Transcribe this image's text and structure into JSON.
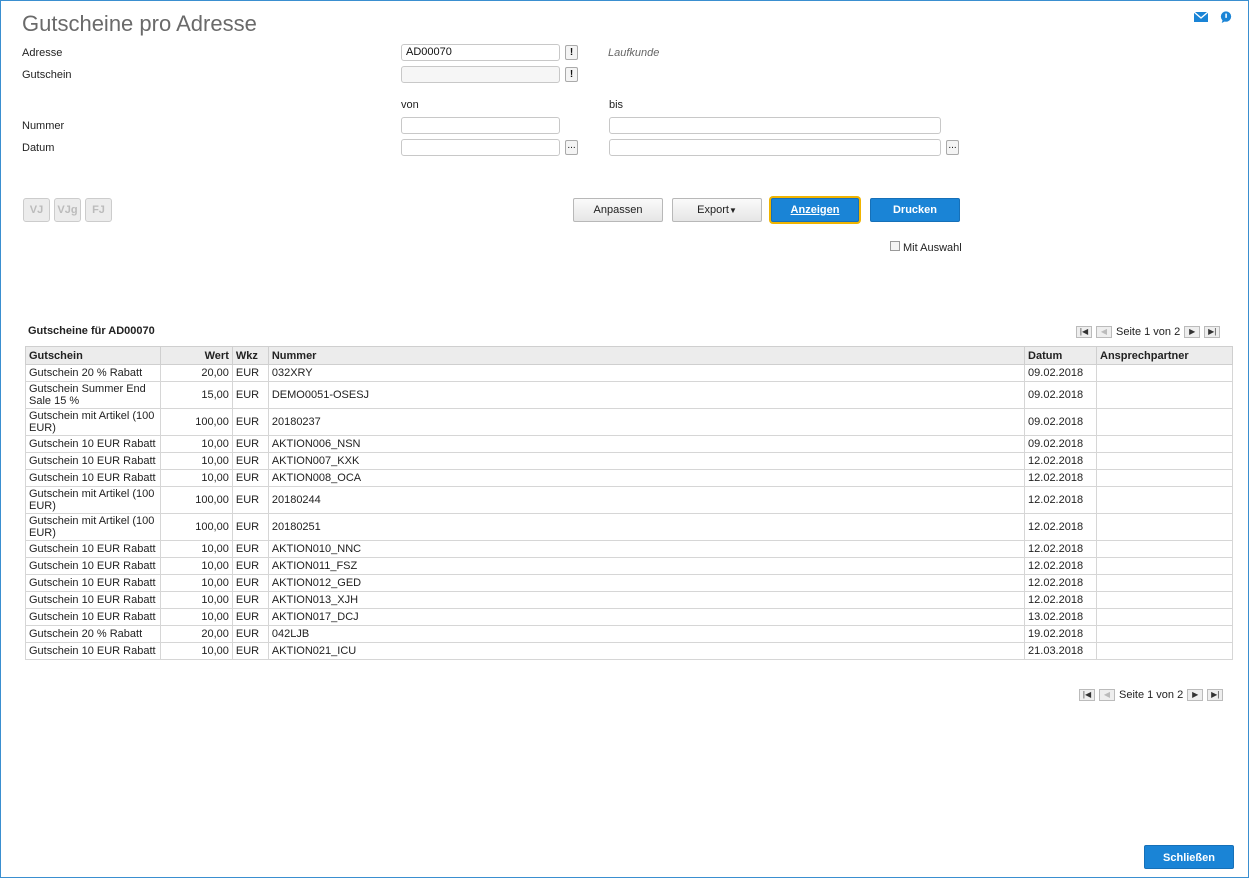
{
  "header": {
    "title": "Gutscheine pro Adresse",
    "icons": [
      "mail-icon",
      "help-chat-icon"
    ]
  },
  "form": {
    "adresse_label": "Adresse",
    "adresse_value": "AD00070",
    "adresse_name": "Laufkunde",
    "gutschein_label": "Gutschein",
    "gutschein_value": "",
    "von_label": "von",
    "bis_label": "bis",
    "nummer_label": "Nummer",
    "datum_label": "Datum",
    "nummer_von": "",
    "nummer_bis": "",
    "datum_von": "",
    "datum_bis": "",
    "info_mark": "!",
    "dots": "..."
  },
  "period_buttons": [
    "VJ",
    "VJg",
    "FJ"
  ],
  "toolbar": {
    "anpassen": "Anpassen",
    "export": "Export",
    "anzeigen": "Anzeigen",
    "drucken": "Drucken",
    "mit_auswahl": "Mit Auswahl"
  },
  "results": {
    "title": "Gutscheine für AD00070",
    "pager_text": "Seite 1 von 2",
    "columns": [
      "Gutschein",
      "Wert",
      "Wkz",
      "Nummer",
      "Datum",
      "Ansprechpartner"
    ],
    "rows": [
      [
        "Gutschein 20 % Rabatt",
        "20,00",
        "EUR",
        "032XRY",
        "09.02.2018",
        ""
      ],
      [
        "Gutschein Summer End Sale 15 %",
        "15,00",
        "EUR",
        "DEMO0051-OSESJ",
        "09.02.2018",
        ""
      ],
      [
        "Gutschein mit Artikel (100 EUR)",
        "100,00",
        "EUR",
        "20180237",
        "09.02.2018",
        ""
      ],
      [
        "Gutschein 10 EUR Rabatt",
        "10,00",
        "EUR",
        "AKTION006_NSN",
        "09.02.2018",
        ""
      ],
      [
        "Gutschein 10 EUR Rabatt",
        "10,00",
        "EUR",
        "AKTION007_KXK",
        "12.02.2018",
        ""
      ],
      [
        "Gutschein 10 EUR Rabatt",
        "10,00",
        "EUR",
        "AKTION008_OCA",
        "12.02.2018",
        ""
      ],
      [
        "Gutschein mit Artikel (100 EUR)",
        "100,00",
        "EUR",
        "20180244",
        "12.02.2018",
        ""
      ],
      [
        "Gutschein mit Artikel (100 EUR)",
        "100,00",
        "EUR",
        "20180251",
        "12.02.2018",
        ""
      ],
      [
        "Gutschein 10 EUR Rabatt",
        "10,00",
        "EUR",
        "AKTION010_NNC",
        "12.02.2018",
        ""
      ],
      [
        "Gutschein 10 EUR Rabatt",
        "10,00",
        "EUR",
        "AKTION011_FSZ",
        "12.02.2018",
        ""
      ],
      [
        "Gutschein 10 EUR Rabatt",
        "10,00",
        "EUR",
        "AKTION012_GED",
        "12.02.2018",
        ""
      ],
      [
        "Gutschein 10 EUR Rabatt",
        "10,00",
        "EUR",
        "AKTION013_XJH",
        "12.02.2018",
        ""
      ],
      [
        "Gutschein 10 EUR Rabatt",
        "10,00",
        "EUR",
        "AKTION017_DCJ",
        "13.02.2018",
        ""
      ],
      [
        "Gutschein 20 % Rabatt",
        "20,00",
        "EUR",
        "042LJB",
        "19.02.2018",
        ""
      ],
      [
        "Gutschein 10 EUR Rabatt",
        "10,00",
        "EUR",
        "AKTION021_ICU",
        "21.03.2018",
        ""
      ]
    ]
  },
  "footer": {
    "close": "Schließen"
  },
  "colors": {
    "primary": "#1a84d6",
    "frame": "#3a8fd0",
    "focus": "#f0b400"
  }
}
